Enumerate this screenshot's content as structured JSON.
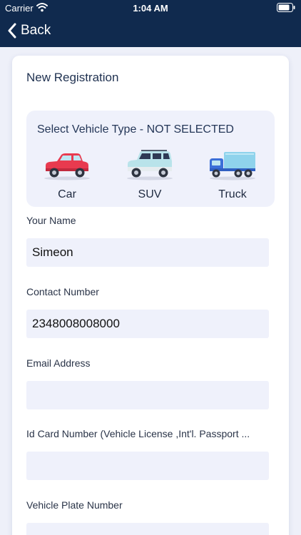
{
  "status_bar": {
    "carrier": "Carrier",
    "time": "1:04 AM"
  },
  "nav": {
    "back_label": "Back"
  },
  "form": {
    "title": "New Registration",
    "vehicle_type": {
      "title": "Select Vehicle Type - NOT SELECTED",
      "options": [
        {
          "label": "Car",
          "icon": "car-icon",
          "color": "#e83a4f"
        },
        {
          "label": "SUV",
          "icon": "suv-icon",
          "color": "#b9e3ea"
        },
        {
          "label": "Truck",
          "icon": "truck-icon",
          "color": "#8fd3ec"
        }
      ]
    },
    "fields": [
      {
        "label": "Your Name",
        "value": "Simeon"
      },
      {
        "label": "Contact Number",
        "value": "2348008008000"
      },
      {
        "label": "Email Address",
        "value": ""
      },
      {
        "label": "Id Card Number (Vehicle License ,Int'l. Passport ...",
        "value": ""
      },
      {
        "label": "Vehicle Plate Number",
        "value": ""
      }
    ]
  },
  "colors": {
    "header": "#102a4e",
    "field_bg": "#eff1fb",
    "page_bg": "#eef0f9"
  }
}
